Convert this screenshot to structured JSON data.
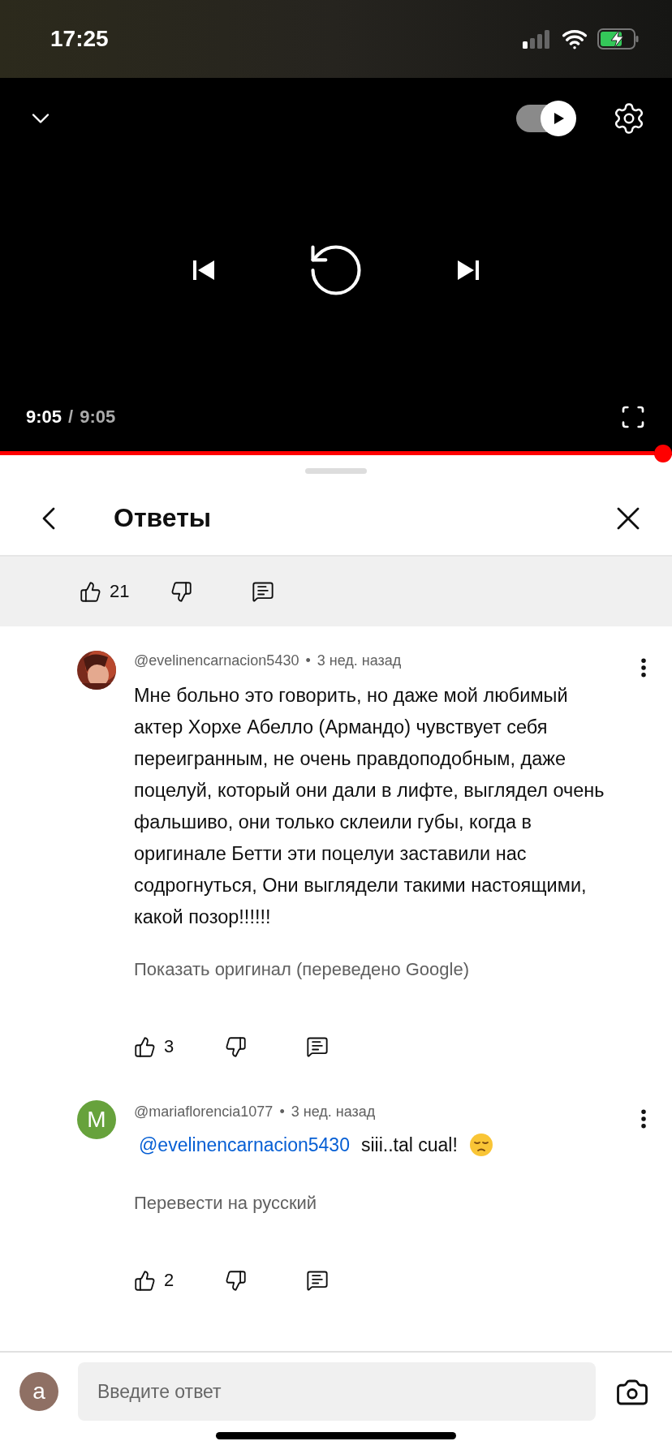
{
  "status_bar": {
    "time": "17:25"
  },
  "player": {
    "autoplay": {
      "on": true
    },
    "elapsed": "9:05",
    "separator": "/",
    "duration": "9:05",
    "progress": {
      "level": 1
    }
  },
  "panel": {
    "title": "Ответы"
  },
  "parent_comment": {
    "likes": "21"
  },
  "replies": [
    {
      "author": "@evelinencarnacion5430",
      "separator": "•",
      "time": "3 нед. назад",
      "text": "Мне больно это говорить, но даже мой любимый актер Хорхе Абелло (Армандо) чувствует себя переигранным, не очень правдоподобным, даже поцелуй, который они дали в лифте, выглядел очень фальшиво, они только склеили губы, когда в оригинале Бетти эти поцелуи заставили нас содрогнуться, Они выглядели такими настоящими, какой позор!!!!!!",
      "translate_link": "Показать оригинал (переведено Google)",
      "likes": "3"
    },
    {
      "author": "@mariaflorencia1077",
      "separator": "•",
      "time": "3 нед. назад",
      "avatar": {
        "kind": "letter",
        "letter": "M",
        "color": "#67a23c"
      },
      "mention": "@evelinencarnacion5430",
      "text": "siii..tal cual!",
      "emoji": {
        "kind": "pensive"
      },
      "translate_link": "Перевести на русский",
      "likes": "2"
    }
  ],
  "composer": {
    "avatar": {
      "letter": "a",
      "color": "#8f7064"
    },
    "placeholder": "Введите ответ"
  }
}
